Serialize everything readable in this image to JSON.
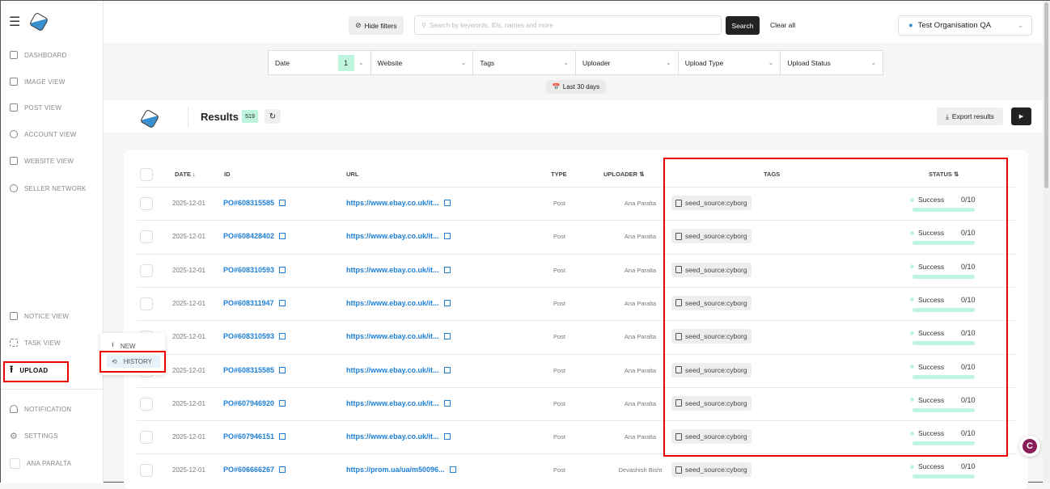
{
  "sidebar": {
    "items": [
      {
        "label": "DASHBOARD",
        "icon": "grid-icon"
      },
      {
        "label": "IMAGE VIEW",
        "icon": "image-icon"
      },
      {
        "label": "POST VIEW",
        "icon": "document-icon"
      },
      {
        "label": "ACCOUNT VIEW",
        "icon": "user-circle-icon"
      },
      {
        "label": "WEBSITE VIEW",
        "icon": "browser-icon"
      },
      {
        "label": "SELLER NETWORK",
        "icon": "network-icon"
      }
    ],
    "lower": [
      {
        "label": "NOTICE VIEW"
      },
      {
        "label": "TASK VIEW"
      },
      {
        "label": "UPLOAD"
      }
    ],
    "bottom": [
      {
        "label": "NOTIFICATION"
      },
      {
        "label": "SETTINGS"
      },
      {
        "label": "ANA PARALTA"
      }
    ]
  },
  "upload_menu": {
    "new": "NEW",
    "history": "HISTORY"
  },
  "topbar": {
    "hide_filters": "Hide filters",
    "search_placeholder": "Search by keywords, IDs, names and more",
    "search": "Search",
    "clear_all": "Clear all",
    "org": "Test Organisation QA"
  },
  "filters": [
    {
      "label": "Date",
      "count": "1"
    },
    {
      "label": "Website"
    },
    {
      "label": "Tags"
    },
    {
      "label": "Uploader"
    },
    {
      "label": "Upload Type"
    },
    {
      "label": "Upload Status"
    }
  ],
  "date_range": "Last 30 days",
  "results": {
    "title": "Results",
    "count": "519",
    "export": "Export results"
  },
  "table": {
    "headers": {
      "date": "DATE",
      "id": "ID",
      "url": "URL",
      "type": "TYPE",
      "uploader": "UPLOADER",
      "tags": "TAGS",
      "status": "STATUS"
    },
    "rows": [
      {
        "date": "2025-12-01",
        "id": "PO#608315585",
        "url": "https://www.ebay.co.uk/it...",
        "type": "Post",
        "uploader": "Ana Paralta",
        "tag": "seed_source:cyborg",
        "status": "Success",
        "progress": "0/10"
      },
      {
        "date": "2025-12-01",
        "id": "PO#608428402",
        "url": "https://www.ebay.co.uk/it...",
        "type": "Post",
        "uploader": "Ana Paralta",
        "tag": "seed_source:cyborg",
        "status": "Success",
        "progress": "0/10"
      },
      {
        "date": "2025-12-01",
        "id": "PO#608310593",
        "url": "https://www.ebay.co.uk/it...",
        "type": "Post",
        "uploader": "Ana Paralta",
        "tag": "seed_source:cyborg",
        "status": "Success",
        "progress": "0/10"
      },
      {
        "date": "2025-12-01",
        "id": "PO#608311947",
        "url": "https://www.ebay.co.uk/it...",
        "type": "Post",
        "uploader": "Ana Paralta",
        "tag": "seed_source:cyborg",
        "status": "Success",
        "progress": "0/10"
      },
      {
        "date": "2025-12-01",
        "id": "PO#608310593",
        "url": "https://www.ebay.co.uk/it...",
        "type": "Post",
        "uploader": "Ana Paralta",
        "tag": "seed_source:cyborg",
        "status": "Success",
        "progress": "0/10"
      },
      {
        "date": "2025-12-01",
        "id": "PO#608315585",
        "url": "https://www.ebay.co.uk/it...",
        "type": "Post",
        "uploader": "Ana Paralta",
        "tag": "seed_source:cyborg",
        "status": "Success",
        "progress": "0/10"
      },
      {
        "date": "2025-12-01",
        "id": "PO#607946920",
        "url": "https://www.ebay.co.uk/it...",
        "type": "Post",
        "uploader": "Ana Paralta",
        "tag": "seed_source:cyborg",
        "status": "Success",
        "progress": "0/10"
      },
      {
        "date": "2025-12-01",
        "id": "PO#607946151",
        "url": "https://www.ebay.co.uk/it...",
        "type": "Post",
        "uploader": "Ana Paralta",
        "tag": "seed_source:cyborg",
        "status": "Success",
        "progress": "0/10"
      },
      {
        "date": "2025-12-01",
        "id": "PO#606666267",
        "url": "https://prom.ua/ua/m50096...",
        "type": "Post",
        "uploader": "Devashish Bisht",
        "tag": "seed_source:cyborg",
        "status": "Success",
        "progress": "0/10"
      }
    ]
  },
  "colors": {
    "accent": "#bff5df",
    "link": "#1e7fd6",
    "highlight": "#ee0000"
  }
}
